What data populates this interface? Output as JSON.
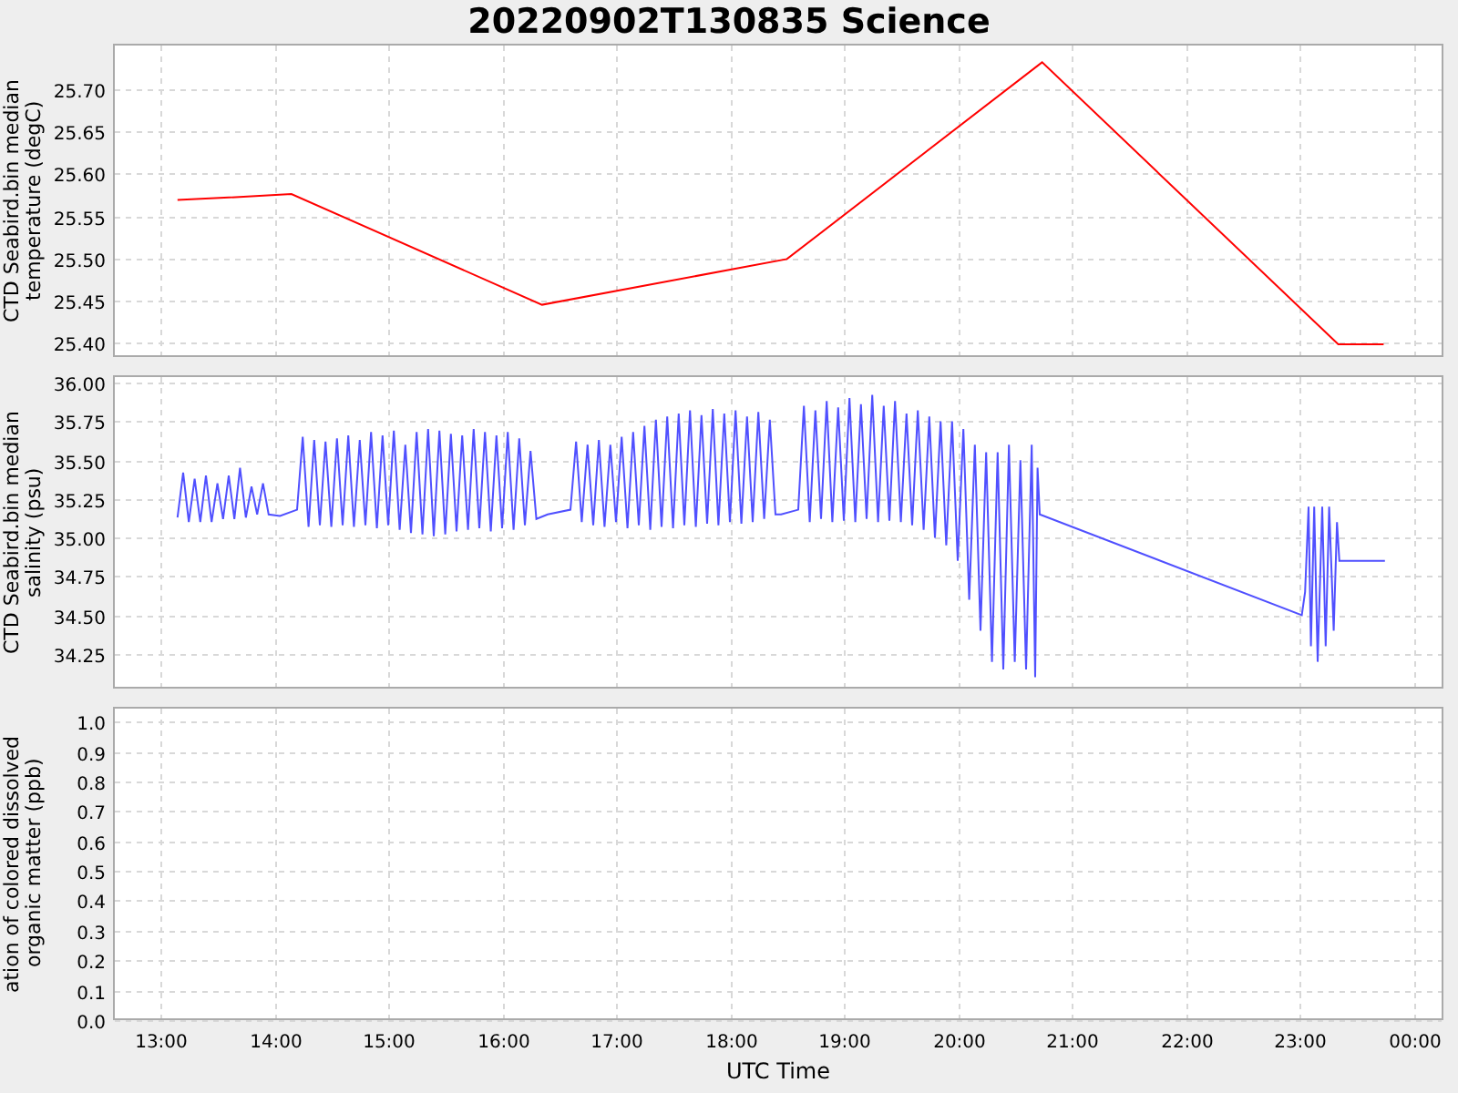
{
  "title": "20220902T130835 Science",
  "panels": [
    {
      "chart_data": {
        "type": "line",
        "grid": true,
        "ylabel": "CTD Seabird.bin median temperature (degC)",
        "xlim": [
          12.584,
          24.264
        ],
        "ylim": [
          25.383,
          25.754
        ],
        "yticks": [
          {
            "value": 25.4,
            "label": "25.40"
          },
          {
            "value": 25.45,
            "label": "25.45"
          },
          {
            "value": 25.5,
            "label": "25.50"
          },
          {
            "value": 25.55,
            "label": "25.55"
          },
          {
            "value": 25.6,
            "label": "25.60"
          },
          {
            "value": 25.65,
            "label": "25.65"
          },
          {
            "value": 25.7,
            "label": "25.70"
          }
        ],
        "x": [
          13.15,
          13.6,
          14.15,
          16.35,
          18.5,
          20.74,
          23.34,
          23.74
        ],
        "series": [
          {
            "color": "#ff0000",
            "values": [
              25.569,
              25.572,
              25.576,
              25.445,
              25.499,
              25.732,
              25.398,
              25.398
            ]
          }
        ]
      }
    },
    {
      "chart_data": {
        "type": "line",
        "grid": true,
        "ylabel": "CTD Seabird.bin median salinity (psu)",
        "xlim": [
          12.584,
          24.264
        ],
        "ylim": [
          34.027,
          36.047
        ],
        "yticks": [
          {
            "value": 34.25,
            "label": "34.25"
          },
          {
            "value": 34.5,
            "label": "34.50"
          },
          {
            "value": 34.75,
            "label": "34.75"
          },
          {
            "value": 35,
            "label": "35.00"
          },
          {
            "value": 35.25,
            "label": "35.25"
          },
          {
            "value": 35.5,
            "label": "35.50"
          },
          {
            "value": 35.75,
            "label": "35.75"
          },
          {
            "value": 36,
            "label": "36.00"
          }
        ],
        "x": [
          13.15,
          13.2,
          13.25,
          13.3,
          13.35,
          13.4,
          13.45,
          13.5,
          13.55,
          13.6,
          13.65,
          13.7,
          13.75,
          13.8,
          13.85,
          13.9,
          13.95,
          14.05,
          14.2,
          14.25,
          14.3,
          14.35,
          14.4,
          14.45,
          14.5,
          14.55,
          14.6,
          14.65,
          14.7,
          14.75,
          14.8,
          14.85,
          14.9,
          14.95,
          15,
          15.05,
          15.1,
          15.15,
          15.2,
          15.25,
          15.3,
          15.35,
          15.4,
          15.45,
          15.5,
          15.55,
          15.6,
          15.65,
          15.7,
          15.75,
          15.8,
          15.85,
          15.9,
          15.95,
          16,
          16.05,
          16.1,
          16.15,
          16.2,
          16.25,
          16.3,
          16.4,
          16.6,
          16.65,
          16.7,
          16.75,
          16.8,
          16.85,
          16.9,
          16.95,
          17,
          17.05,
          17.1,
          17.15,
          17.2,
          17.25,
          17.3,
          17.35,
          17.4,
          17.45,
          17.5,
          17.55,
          17.6,
          17.65,
          17.7,
          17.75,
          17.8,
          17.85,
          17.9,
          17.95,
          18,
          18.05,
          18.1,
          18.15,
          18.2,
          18.25,
          18.3,
          18.35,
          18.4,
          18.45,
          18.6,
          18.65,
          18.7,
          18.75,
          18.8,
          18.85,
          18.9,
          18.95,
          19,
          19.05,
          19.1,
          19.15,
          19.2,
          19.25,
          19.3,
          19.35,
          19.4,
          19.45,
          19.5,
          19.55,
          19.6,
          19.65,
          19.7,
          19.75,
          19.8,
          19.85,
          19.9,
          19.95,
          20,
          20.05,
          20.1,
          20.15,
          20.2,
          20.25,
          20.3,
          20.35,
          20.4,
          20.45,
          20.5,
          20.55,
          20.6,
          20.65,
          20.68,
          20.7,
          20.72,
          23.02,
          23.05,
          23.08,
          23.1,
          23.13,
          23.16,
          23.2,
          23.23,
          23.26,
          23.3,
          23.33,
          23.35,
          23.75
        ],
        "series": [
          {
            "color": "#5050ff",
            "values": [
              35.13,
              35.42,
              35.1,
              35.38,
              35.1,
              35.4,
              35.1,
              35.35,
              35.12,
              35.4,
              35.12,
              35.45,
              35.13,
              35.33,
              35.15,
              35.35,
              35.15,
              35.14,
              35.18,
              35.65,
              35.07,
              35.63,
              35.08,
              35.62,
              35.07,
              35.64,
              35.08,
              35.66,
              35.07,
              35.63,
              35.08,
              35.68,
              35.06,
              35.66,
              35.08,
              35.69,
              35.05,
              35.6,
              35.03,
              35.68,
              35.02,
              35.7,
              35.01,
              35.69,
              35.02,
              35.67,
              35.04,
              35.66,
              35.05,
              35.7,
              35.06,
              35.68,
              35.04,
              35.66,
              35.06,
              35.68,
              35.05,
              35.64,
              35.08,
              35.56,
              35.12,
              35.15,
              35.18,
              35.62,
              35.1,
              35.6,
              35.08,
              35.63,
              35.07,
              35.6,
              35.1,
              35.65,
              35.06,
              35.68,
              35.08,
              35.72,
              35.05,
              35.76,
              35.07,
              35.78,
              35.06,
              35.8,
              35.08,
              35.82,
              35.07,
              35.79,
              35.09,
              35.83,
              35.08,
              35.8,
              35.1,
              35.82,
              35.09,
              35.78,
              35.1,
              35.81,
              35.12,
              35.76,
              35.15,
              35.15,
              35.18,
              35.85,
              35.1,
              35.82,
              35.12,
              35.88,
              35.1,
              35.84,
              35.11,
              35.9,
              35.1,
              35.86,
              35.12,
              35.92,
              35.1,
              35.85,
              35.11,
              35.88,
              35.1,
              35.8,
              35.08,
              35.82,
              35.05,
              35.78,
              35.0,
              35.75,
              34.95,
              35.75,
              34.85,
              35.7,
              34.6,
              35.6,
              34.4,
              35.55,
              34.2,
              35.55,
              34.15,
              35.6,
              34.2,
              35.5,
              34.15,
              35.6,
              34.1,
              35.45,
              35.15,
              34.5,
              34.65,
              35.2,
              34.3,
              35.2,
              34.2,
              35.2,
              34.3,
              35.2,
              34.4,
              35.1,
              34.85,
              34.85
            ]
          }
        ]
      }
    },
    {
      "chart_data": {
        "type": "line",
        "grid": true,
        "ylabel": "ation of colored dissolved organic matter (ppb)",
        "xlabel": "UTC Time",
        "xlim": [
          12.584,
          24.264
        ],
        "ylim": [
          0,
          1.05
        ],
        "xticks": [
          {
            "value": 13,
            "label": "13:00"
          },
          {
            "value": 14,
            "label": "14:00"
          },
          {
            "value": 15,
            "label": "15:00"
          },
          {
            "value": 16,
            "label": "16:00"
          },
          {
            "value": 17,
            "label": "17:00"
          },
          {
            "value": 18,
            "label": "18:00"
          },
          {
            "value": 19,
            "label": "19:00"
          },
          {
            "value": 20,
            "label": "20:00"
          },
          {
            "value": 21,
            "label": "21:00"
          },
          {
            "value": 22,
            "label": "22:00"
          },
          {
            "value": 23,
            "label": "23:00"
          },
          {
            "value": 24,
            "label": "00:00"
          }
        ],
        "yticks": [
          {
            "value": 0,
            "label": "0.0"
          },
          {
            "value": 0.1,
            "label": "0.1"
          },
          {
            "value": 0.2,
            "label": "0.2"
          },
          {
            "value": 0.3,
            "label": "0.3"
          },
          {
            "value": 0.4,
            "label": "0.4"
          },
          {
            "value": 0.5,
            "label": "0.5"
          },
          {
            "value": 0.6,
            "label": "0.6"
          },
          {
            "value": 0.7,
            "label": "0.7"
          },
          {
            "value": 0.8,
            "label": "0.8"
          },
          {
            "value": 0.9,
            "label": "0.9"
          },
          {
            "value": 1,
            "label": "1.0"
          }
        ]
      }
    }
  ]
}
